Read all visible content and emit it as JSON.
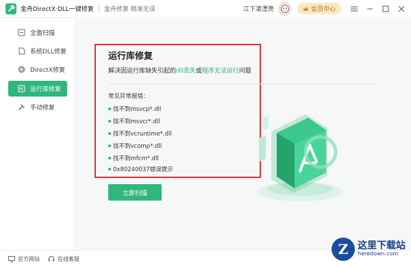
{
  "titlebar": {
    "app_title": "金舟DirectX·DLL一键修复",
    "subtitle": "金舟修复 精准无误",
    "user_name": "江下凌漂亮",
    "vip_label": "会员中心",
    "menu_icon": "menu-icon",
    "minimize_icon": "minimize-icon",
    "maximize_icon": "maximize-icon",
    "close_icon": "close-icon"
  },
  "sidebar": {
    "items": [
      {
        "label": "全面扫描",
        "icon": "scan-icon"
      },
      {
        "label": "系统DLL修复",
        "icon": "file-icon"
      },
      {
        "label": "DirectX修复",
        "icon": "x-icon"
      },
      {
        "label": "运行库修复",
        "icon": "runtime-icon",
        "active": true
      },
      {
        "label": "手动修复",
        "icon": "tools-icon"
      }
    ]
  },
  "main": {
    "title": "运行库修复",
    "desc_prefix": "解决因运行库缺失引起的",
    "desc_hl1": "dll丢失",
    "desc_mid": "或",
    "desc_hl2": "程序无法运行",
    "desc_suffix": "问题",
    "list_title": "常见异常报错：",
    "errors": [
      "找不到msvcp*.dll",
      "找不到msvcr*.dll",
      "找不到vcruntime*.dll",
      "找不到vcomp*.dll",
      "找不到mfcm*.dll",
      "0x80240037错误提示"
    ],
    "scan_button": "立即扫描"
  },
  "footer": {
    "website": "官方网站",
    "support": "在线客服"
  },
  "watermark": {
    "logo_letter": "Z",
    "name": "这里下载站",
    "url": "heredown.com"
  },
  "colors": {
    "accent": "#2fb77d",
    "highlight_box": "#e03030",
    "vip_bg": "#fbe9c6"
  }
}
